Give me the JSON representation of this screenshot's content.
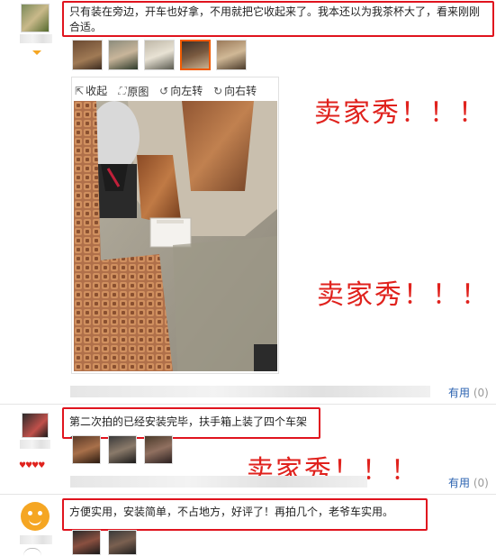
{
  "reviews": [
    {
      "text": "只有装在旁边，开车也好拿，不用就把它收起来了。我本还以为我茶杯大了，看来刚刚合适。",
      "tools": {
        "collapse": "收起",
        "original": "原图",
        "rotate_left": "向左转",
        "rotate_right": "向右转"
      },
      "helpful_label": "有用",
      "helpful_count": "(0)"
    },
    {
      "text": "第二次拍的已经安装完毕，扶手箱上装了四个车架~",
      "helpful_label": "有用",
      "helpful_count": "(0)"
    },
    {
      "text": "方便实用，安装简单，不占地方，好评了！再拍几个，老爷车实用。"
    }
  ],
  "annotations": {
    "a1": "卖家秀！！！",
    "a2": "卖家秀！！！",
    "a3": "卖家秀！！！"
  },
  "colors": {
    "annotation_red": "#e0221d",
    "box_red": "#e0141e",
    "link_blue": "#2a62b0",
    "selected_thumb": "#f05a00"
  },
  "icons": [
    "collapse-icon",
    "original-image-icon",
    "rotate-left-icon",
    "rotate-right-icon",
    "dropdown-arrow-icon"
  ]
}
